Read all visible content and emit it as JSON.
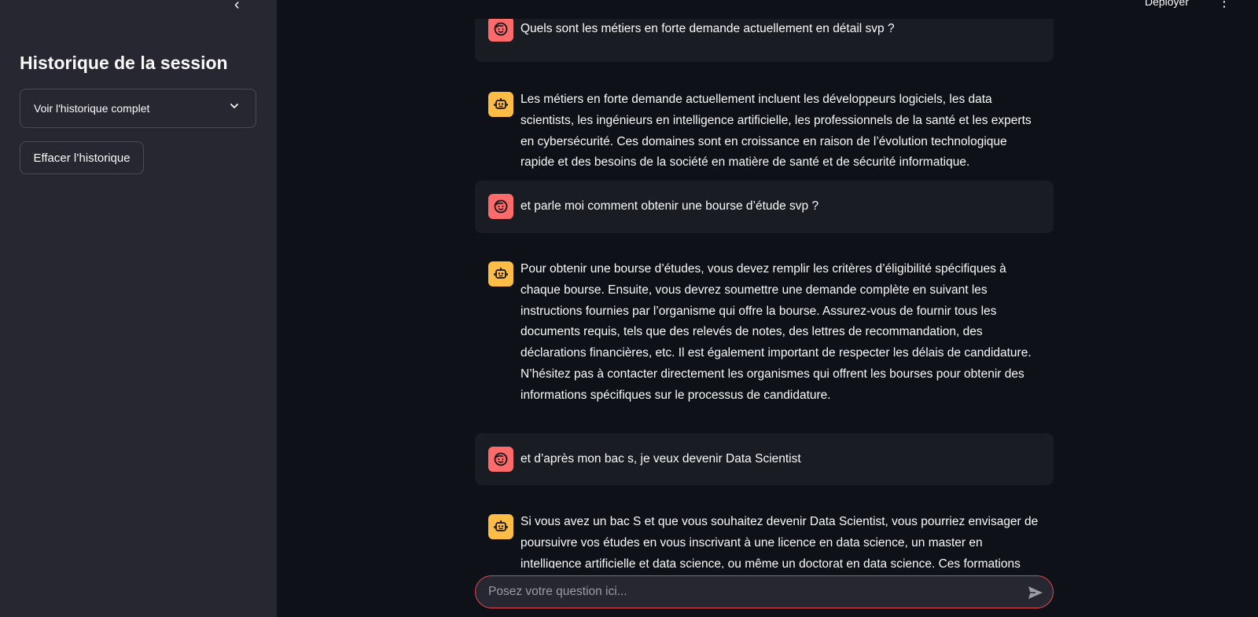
{
  "sidebar": {
    "collapse_glyph": "‹",
    "title": "Historique de la session",
    "history_select": {
      "selected": "Voir l'historique complet"
    },
    "clear_button": "Effacer l’historique"
  },
  "header": {
    "deploy_label": "Déployer",
    "menu_glyph": "⋮"
  },
  "messages": [
    {
      "role": "user",
      "text": "Quels sont les métiers en forte demande actuellement en détail svp ?"
    },
    {
      "role": "assistant",
      "text": "Les métiers en forte demande actuellement incluent les développeurs logiciels, les data scientists, les ingénieurs en intelligence artificielle, les professionnels de la santé et les experts en cybersécurité. Ces domaines sont en croissance en raison de l’évolution technologique rapide et des besoins de la société en matière de santé et de sécurité informatique."
    },
    {
      "role": "user",
      "text": "et parle moi comment obtenir une bourse d’étude svp ?"
    },
    {
      "role": "assistant",
      "text": "Pour obtenir une bourse d’études, vous devez remplir les critères d’éligibilité spécifiques à chaque bourse. Ensuite, vous devrez soumettre une demande complète en suivant les instructions fournies par l’organisme qui offre la bourse. Assurez-vous de fournir tous les documents requis, tels que des relevés de notes, des lettres de recommandation, des déclarations financières, etc. Il est également important de respecter les délais de candidature. N’hésitez pas à contacter directement les organismes qui offrent les bourses pour obtenir des informations spécifiques sur le processus de candidature."
    },
    {
      "role": "user",
      "text": "et d’après mon bac s, je veux devenir Data Scientist"
    },
    {
      "role": "assistant",
      "text": "Si vous avez un bac S et que vous souhaitez devenir Data Scientist, vous pourriez envisager de poursuivre vos études en vous inscrivant à une licence en data science, un master en intelligence artificielle et data science, ou même un doctorat en data science. Ces formations vous"
    }
  ],
  "chat_input": {
    "placeholder": "Posez votre question ici..."
  },
  "colors": {
    "user_avatar": "#ff6b6b",
    "assistant_avatar": "#ffbd45",
    "input_border": "#e0464e",
    "sidebar_bg": "#262730",
    "main_bg": "#0e1117"
  },
  "icons": {
    "user_avatar": "smiley-face-icon",
    "assistant_avatar": "robot-icon",
    "send": "send-icon",
    "chevron": "chevron-down-icon",
    "collapse": "chevron-left-icon",
    "menu": "vertical-dots-icon"
  }
}
